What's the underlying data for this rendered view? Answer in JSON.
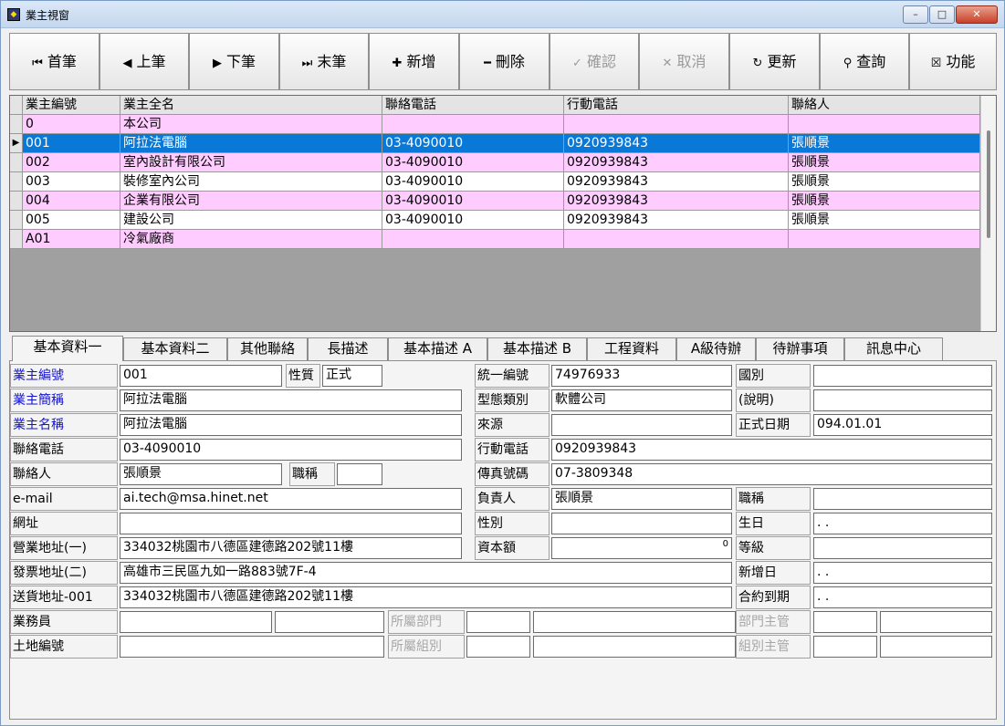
{
  "window": {
    "title": "業主視窗",
    "controls": {
      "minimize": "–",
      "maximize": "□",
      "close": "✕"
    }
  },
  "toolbar": {
    "buttons": [
      {
        "id": "first",
        "glyph": "⏮",
        "label": "首筆",
        "enabled": true
      },
      {
        "id": "prev",
        "glyph": "◀",
        "label": "上筆",
        "enabled": true
      },
      {
        "id": "next",
        "glyph": "▶",
        "label": "下筆",
        "enabled": true
      },
      {
        "id": "last",
        "glyph": "⏭",
        "label": "末筆",
        "enabled": true
      },
      {
        "id": "add",
        "glyph": "✚",
        "label": "新增",
        "enabled": true
      },
      {
        "id": "delete",
        "glyph": "━",
        "label": "刪除",
        "enabled": true
      },
      {
        "id": "confirm",
        "glyph": "✓",
        "label": "確認",
        "enabled": false
      },
      {
        "id": "cancel",
        "glyph": "✕",
        "label": "取消",
        "enabled": false
      },
      {
        "id": "refresh",
        "glyph": "↻",
        "label": "更新",
        "enabled": true
      },
      {
        "id": "query",
        "glyph": "⚲",
        "label": "查詢",
        "enabled": true
      },
      {
        "id": "function",
        "glyph": "☒",
        "label": "功能",
        "enabled": true
      }
    ]
  },
  "grid": {
    "headers": [
      "業主編號",
      "業主全名",
      "聯絡電話",
      "行動電話",
      "聯絡人"
    ],
    "rows": [
      {
        "cells": [
          "0",
          "本公司",
          "",
          "",
          ""
        ],
        "style": "pink",
        "current": false
      },
      {
        "cells": [
          "001",
          "阿拉法電腦",
          "03-4090010",
          "0920939843",
          "張順景"
        ],
        "style": "sel",
        "current": true
      },
      {
        "cells": [
          "002",
          "室內設計有限公司",
          "03-4090010",
          "0920939843",
          "張順景"
        ],
        "style": "pink",
        "current": false
      },
      {
        "cells": [
          "003",
          "裝修室內公司",
          "03-4090010",
          "0920939843",
          "張順景"
        ],
        "style": "white",
        "current": false
      },
      {
        "cells": [
          "004",
          "企業有限公司",
          "03-4090010",
          "0920939843",
          "張順景"
        ],
        "style": "pink",
        "current": false
      },
      {
        "cells": [
          "005",
          "建設公司",
          "03-4090010",
          "0920939843",
          "張順景"
        ],
        "style": "white",
        "current": false
      },
      {
        "cells": [
          "A01",
          "冷氣廠商",
          "",
          "",
          ""
        ],
        "style": "pink",
        "current": false
      }
    ],
    "current_marker": "▶"
  },
  "tabs": [
    "基本資料一",
    "基本資料二",
    "其他聯絡",
    "長描述",
    "基本描述 A",
    "基本描述 B",
    "工程資料",
    "A級待辦",
    "待辦事項",
    "訊息中心"
  ],
  "form": {
    "labels": {
      "owner_no": "業主編號",
      "nature": "性質",
      "tax_id": "統一編號",
      "country": "國別",
      "short_name": "業主簡稱",
      "type": "型態類別",
      "note": "(說明)",
      "full_name": "業主名稱",
      "source": "來源",
      "formal_date": "正式日期",
      "phone": "聯絡電話",
      "mobile": "行動電話",
      "contact": "聯絡人",
      "contact_title": "職稱",
      "fax": "傳真號碼",
      "email": "e-mail",
      "owner": "負責人",
      "owner_title": "職稱",
      "website": "網址",
      "gender": "性別",
      "birthday": "生日",
      "business_addr": "營業地址(一)",
      "capital": "資本額",
      "grade": "等級",
      "invoice_addr": "發票地址(二)",
      "added_date": "新增日",
      "delivery_addr": "送貨地址-001",
      "contract_due": "合約到期",
      "salesman": "業務員",
      "department": "所屬部門",
      "dept_manager": "部門主管",
      "land_no": "土地編號",
      "group": "所屬組別",
      "group_manager": "組別主管"
    },
    "values": {
      "owner_no": "001",
      "nature": "正式",
      "tax_id": "74976933",
      "country": "",
      "short_name": "阿拉法電腦",
      "type": "軟體公司",
      "note": "",
      "full_name": "阿拉法電腦",
      "source": "",
      "formal_date": "094.01.01",
      "phone": "03-4090010",
      "mobile": "0920939843",
      "contact": "張順景",
      "contact_title": "",
      "fax": "07-3809348",
      "email": "ai.tech@msa.hinet.net",
      "owner": "張順景",
      "owner_title": "",
      "website": "",
      "gender": "",
      "birthday": ". .",
      "business_addr": "334032桃園市八德區建德路202號11樓",
      "capital": "0",
      "grade": "",
      "invoice_addr": "高雄市三民區九如一路883號7F-4",
      "added_date": ". .",
      "delivery_addr": "334032桃園市八德區建德路202號11樓",
      "contract_due": ". .",
      "salesman_code": "",
      "salesman_name": "",
      "department_code": "",
      "department_name": "",
      "dept_manager_code": "",
      "dept_manager_name": "",
      "land_no": "",
      "group_code": "",
      "group_name": "",
      "group_manager_code": "",
      "group_manager_name": ""
    }
  },
  "colors": {
    "selected_row": "#0a78d7",
    "pink_row": "#ffccff",
    "required_label": "#1515c8"
  }
}
